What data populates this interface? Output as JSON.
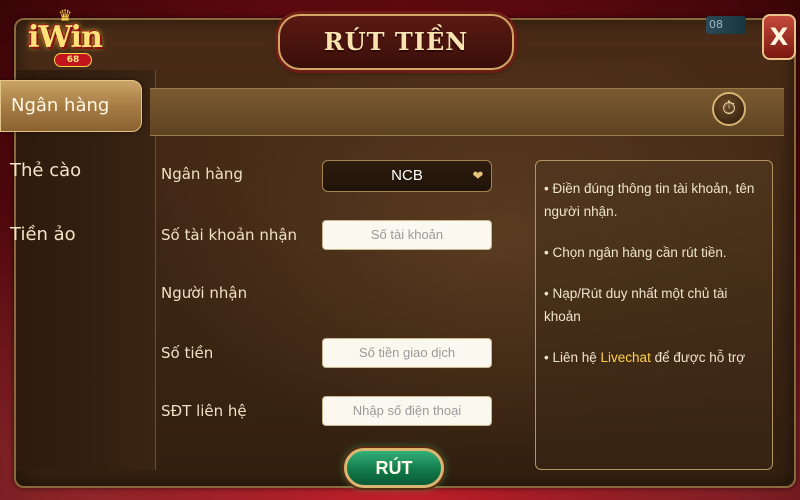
{
  "brand": {
    "logo_text": "iWin",
    "logo_sub": "68"
  },
  "title": "RÚT TIỀN",
  "corner_number": "08",
  "close_label": "X",
  "nav": {
    "items": [
      {
        "label": "Ngân hàng",
        "active": true
      },
      {
        "label": "Thẻ cào",
        "active": false
      },
      {
        "label": "Tiền ảo",
        "active": false
      }
    ]
  },
  "form": {
    "bank_label": "Ngân hàng",
    "bank_value": "NCB",
    "account_label": "Số tài khoản nhận",
    "account_placeholder": "Số tài khoản",
    "receiver_label": "Người nhận",
    "amount_label": "Số tiền",
    "amount_placeholder": "Số tiền giao dịch",
    "phone_label": "SĐT liên hệ",
    "phone_placeholder": "Nhập số điện thoại",
    "submit_label": "RÚT"
  },
  "tips": {
    "tip1": "Điền đúng thông tin tài khoản, tên người nhận.",
    "tip2": "Chọn ngân hàng cần rút tiền.",
    "tip3": "Nạp/Rút duy nhất một chủ tài khoản",
    "tip4_prefix": "Liên hệ ",
    "tip4_highlight": "Livechat",
    "tip4_suffix": " để được hỗ trợ"
  },
  "colors": {
    "accent": "#ffd24a",
    "panel": "#3b2413",
    "submit": "#117a4a"
  }
}
